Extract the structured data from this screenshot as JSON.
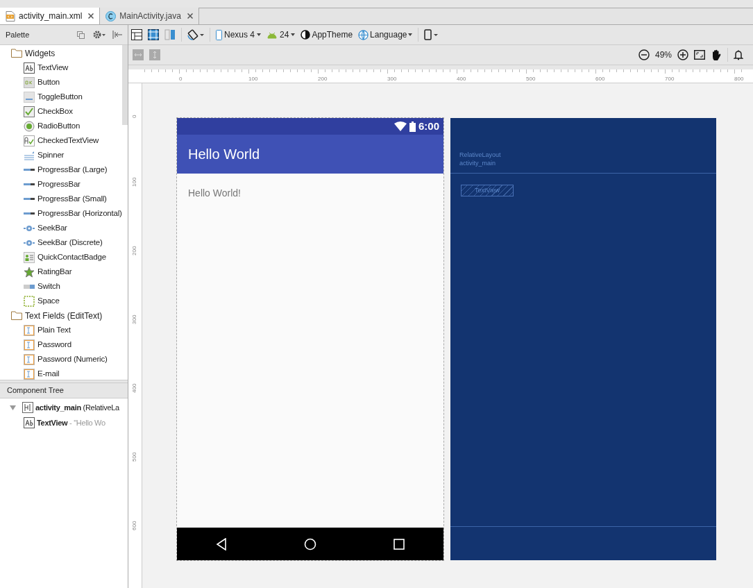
{
  "tabs": [
    {
      "label": "activity_main.xml",
      "selected": true,
      "kind": "xml"
    },
    {
      "label": "MainActivity.java",
      "selected": false,
      "kind": "java"
    }
  ],
  "palette": {
    "title": "Palette",
    "groups": [
      {
        "label": "Widgets",
        "items": [
          {
            "label": "TextView",
            "kind": "text"
          },
          {
            "label": "Button",
            "kind": "button"
          },
          {
            "label": "ToggleButton",
            "kind": "toggle"
          },
          {
            "label": "CheckBox",
            "kind": "check"
          },
          {
            "label": "RadioButton",
            "kind": "radio"
          },
          {
            "label": "CheckedTextView",
            "kind": "checkedtext"
          },
          {
            "label": "Spinner",
            "kind": "spinner"
          },
          {
            "label": "ProgressBar (Large)",
            "kind": "progress"
          },
          {
            "label": "ProgressBar",
            "kind": "progress"
          },
          {
            "label": "ProgressBar (Small)",
            "kind": "progress"
          },
          {
            "label": "ProgressBar (Horizontal)",
            "kind": "progress"
          },
          {
            "label": "SeekBar",
            "kind": "seek"
          },
          {
            "label": "SeekBar (Discrete)",
            "kind": "seek"
          },
          {
            "label": "QuickContactBadge",
            "kind": "badge"
          },
          {
            "label": "RatingBar",
            "kind": "star"
          },
          {
            "label": "Switch",
            "kind": "switch"
          },
          {
            "label": "Space",
            "kind": "space"
          }
        ]
      },
      {
        "label": "Text Fields (EditText)",
        "items": [
          {
            "label": "Plain Text",
            "kind": "edit"
          },
          {
            "label": "Password",
            "kind": "edit"
          },
          {
            "label": "Password (Numeric)",
            "kind": "edit"
          },
          {
            "label": "E-mail",
            "kind": "edit"
          }
        ]
      }
    ]
  },
  "component_tree": {
    "title": "Component Tree",
    "nodes": [
      {
        "label": "activity_main",
        "detail": "(RelativeLa",
        "expanded": true,
        "kind": "layout",
        "children": [
          {
            "label": "TextView",
            "detail": "- \"Hello Wo",
            "kind": "text"
          }
        ]
      }
    ]
  },
  "toolbar": {
    "device": "Nexus 4",
    "api": "24",
    "theme": "AppTheme",
    "language": "Language",
    "zoom": "49%"
  },
  "ruler": {
    "x_labels": [
      "0",
      "100",
      "200",
      "300",
      "400",
      "500",
      "600",
      "700",
      "800"
    ],
    "y_labels": [
      "0",
      "100",
      "200",
      "300",
      "400",
      "500",
      "600"
    ]
  },
  "phone": {
    "time": "6:00",
    "app_title": "Hello World",
    "content_text": "Hello World!"
  },
  "blueprint": {
    "layout_type": "RelativeLayout",
    "layout_id": "activity_main",
    "view_label": "TextView"
  }
}
